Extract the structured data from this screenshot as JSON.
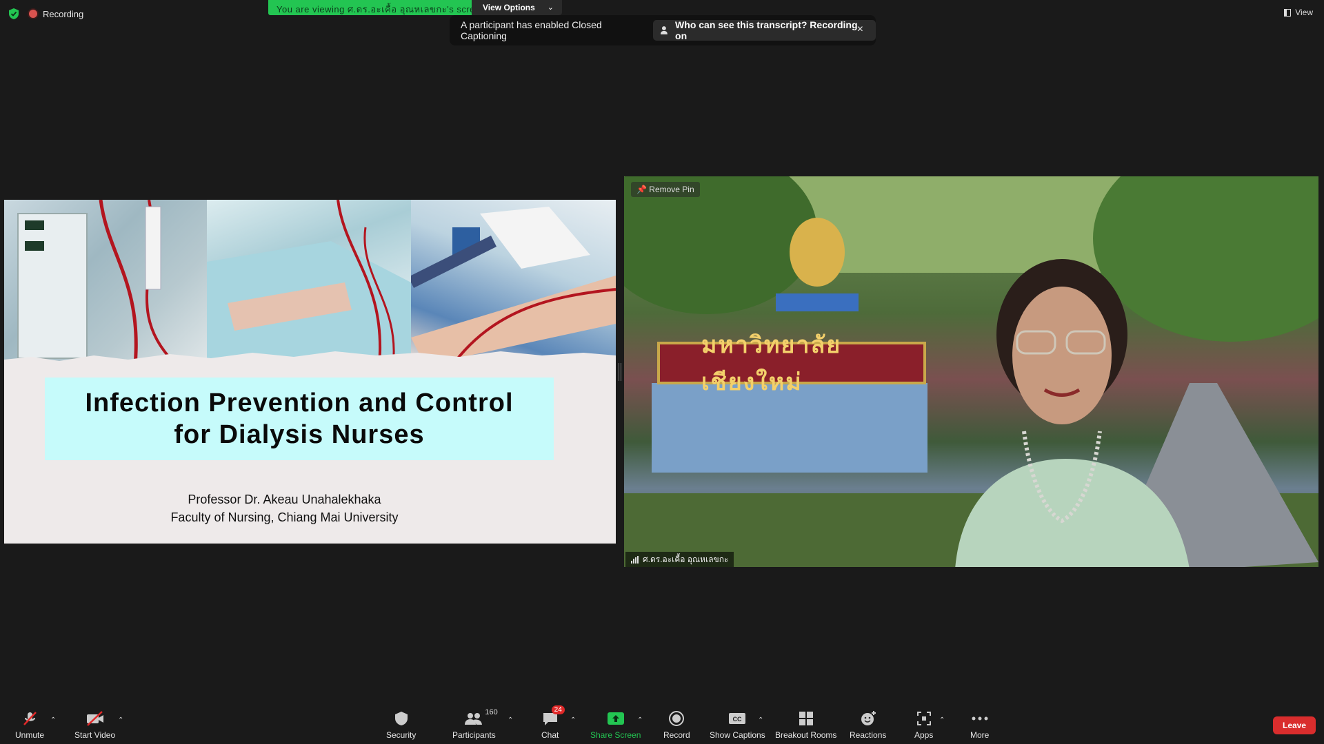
{
  "top_bar": {
    "recording_label": "Recording",
    "viewing_banner": "You are viewing ศ.ดร.อะเคื้อ อุณหเลขกะ's screen",
    "view_options_label": "View Options",
    "view_label": "View"
  },
  "toast": {
    "message": "A participant has enabled Closed Captioning",
    "link_text": "Who can see this transcript? Recording on",
    "close_symbol": "×"
  },
  "slide": {
    "title_line1": "Infection Prevention and Control",
    "title_line2": "for Dialysis Nurses",
    "author": "Professor Dr. Akeau Unahalekhaka",
    "affiliation": "Faculty of Nursing, Chiang Mai University"
  },
  "video": {
    "remove_pin_label": "Remove Pin",
    "participant_name": "ศ.ดร.อะเคื้อ อุณหเลขกะ",
    "sign_text": "มหาวิทยาลัยเชียงใหม่"
  },
  "toolbar": {
    "unmute": "Unmute",
    "start_video": "Start Video",
    "security": "Security",
    "participants": "Participants",
    "participants_count": "160",
    "chat": "Chat",
    "chat_badge": "24",
    "share_screen": "Share Screen",
    "record": "Record",
    "show_captions": "Show Captions",
    "breakout_rooms": "Breakout Rooms",
    "reactions": "Reactions",
    "apps": "Apps",
    "more": "More",
    "leave": "Leave"
  },
  "colors": {
    "background": "#1a1a1a",
    "share_green": "#23c552",
    "leave_red": "#d92d2d",
    "title_box": "#c6fbfb"
  }
}
